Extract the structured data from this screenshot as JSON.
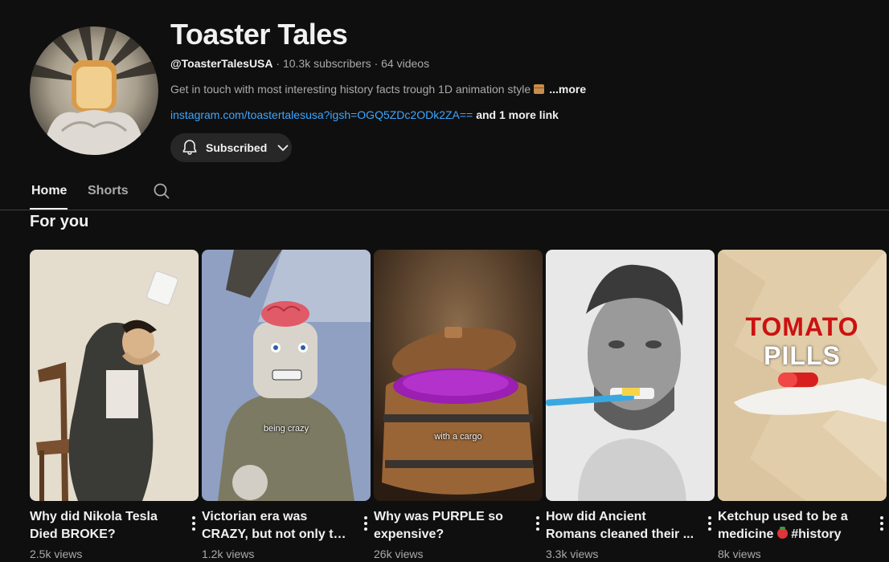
{
  "channel": {
    "title": "Toaster Tales",
    "handle": "@ToasterTalesUSA",
    "subscribers": "10.3k subscribers",
    "videos": "64 videos",
    "meta_sep": " · ",
    "description": "Get in touch with most interesting history facts trough 1D animation style",
    "description_more": "...more",
    "link": "instagram.com/toastertalesusa?igsh=OGQ5ZDc2ODk2ZA==",
    "more_links": "and 1 more link",
    "subscribe_label": "Subscribed"
  },
  "tabs": [
    {
      "label": "Home",
      "active": true
    },
    {
      "label": "Shorts",
      "active": false
    }
  ],
  "section": {
    "title": "For you"
  },
  "videos": [
    {
      "title_line1": "Why did Nikola Tesla",
      "title_line2": "Died BROKE?",
      "views": "2.5k views",
      "overlay": ""
    },
    {
      "title_line1": "Victorian era was",
      "title_line2": "CRAZY, but not only th...",
      "views": "1.2k views",
      "overlay": "being crazy"
    },
    {
      "title_line1": "Why was PURPLE so",
      "title_line2": "expensive?",
      "views": "26k views",
      "overlay": "with a cargo"
    },
    {
      "title_line1": "How did Ancient",
      "title_line2": "Romans cleaned their ...",
      "views": "3.3k views",
      "overlay": ""
    },
    {
      "title_line1": "Ketchup used to be a",
      "title_line2_prefix": "medicine ",
      "title_line2_suffix": " #history",
      "views": "8k views",
      "overlay_line1": "TOMATO",
      "overlay_line2": "PILLS"
    }
  ],
  "colors": {
    "background": "#0f0f0f",
    "link": "#3ea6ff",
    "muted": "#aaaaaa",
    "button": "#272727"
  },
  "icons": {
    "subscribe": "bell-icon",
    "dropdown": "chevron-down-icon",
    "search": "search-icon",
    "menu": "more-vert-icon"
  }
}
